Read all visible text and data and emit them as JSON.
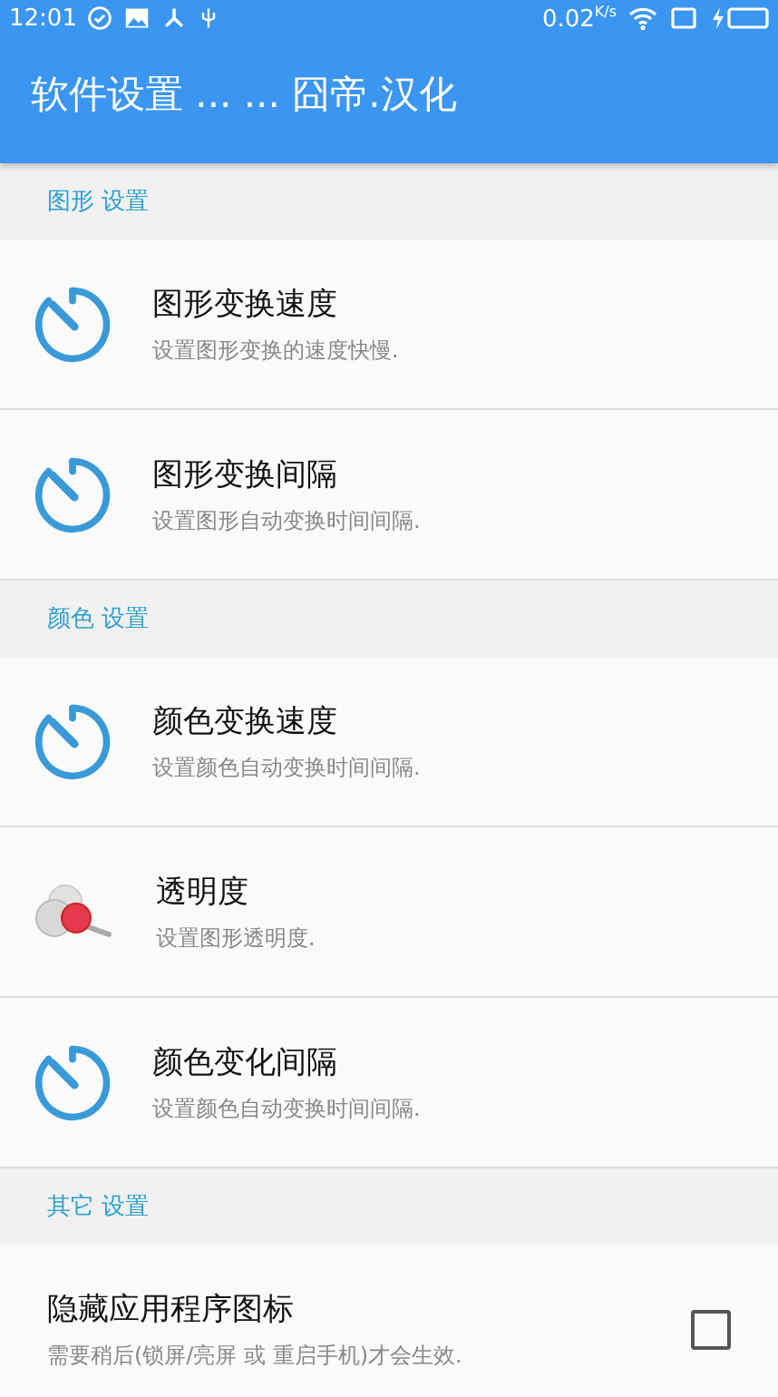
{
  "status_bar": {
    "time": "12:01",
    "speed": "0.02",
    "speed_unit": "K/s"
  },
  "app_bar": {
    "title": "软件设置 ... ... 囧帝.汉化"
  },
  "sections": [
    {
      "header": "图形 设置",
      "items": [
        {
          "kind": "timer",
          "title": "图形变换速度",
          "summary": "设置图形变换的速度快慢."
        },
        {
          "kind": "timer",
          "title": "图形变换间隔",
          "summary": "设置图形自动变换时间间隔."
        }
      ]
    },
    {
      "header": "颜色 设置",
      "items": [
        {
          "kind": "timer",
          "title": "颜色变换速度",
          "summary": "设置颜色自动变换时间间隔."
        },
        {
          "kind": "opacity",
          "title": "透明度",
          "summary": "设置图形透明度."
        },
        {
          "kind": "timer",
          "title": "颜色变化间隔",
          "summary": "设置颜色自动变换时间间隔."
        }
      ]
    },
    {
      "header": "其它 设置",
      "items": [
        {
          "kind": "checkbox",
          "title": "隐藏应用程序图标",
          "summary": "需要稍后(锁屏/亮屏 或 重启手机)才会生效.",
          "checked": false
        }
      ]
    }
  ]
}
